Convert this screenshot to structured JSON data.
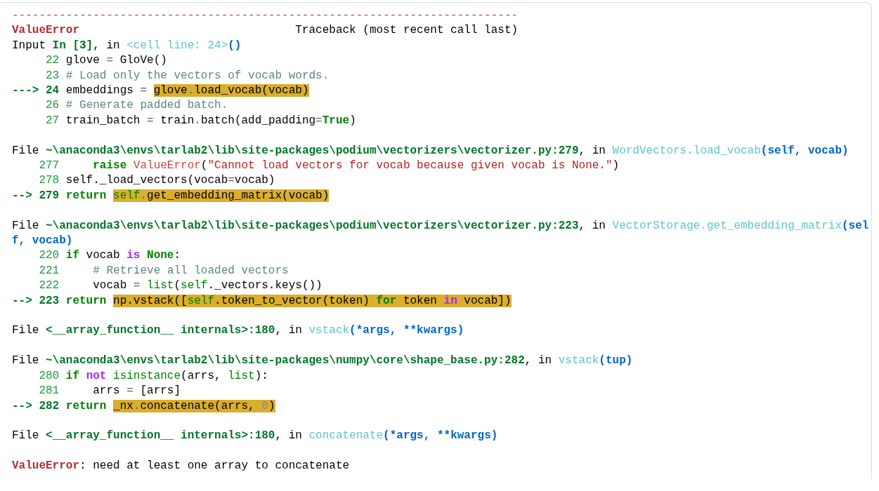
{
  "traceback": {
    "blocks": [
      {
        "lines": [
          {
            "code": [
              {
                "text": "---------------------------------------------------------------------------",
                "kind": "dashes"
              }
            ]
          },
          {
            "code": [
              {
                "text": "ValueError",
                "kind": "error"
              },
              {
                "text": "                                Traceback (most recent call last)",
                "kind": "plain"
              }
            ]
          },
          {
            "code": [
              {
                "text": "Input ",
                "kind": "plain"
              },
              {
                "text": "In [3]",
                "kind": "path"
              },
              {
                "text": ", in ",
                "kind": "plain"
              },
              {
                "text": "<cell line: 24>",
                "kind": "func"
              },
              {
                "text": "()",
                "kind": "args"
              }
            ]
          },
          {
            "code": [
              {
                "text": "     22 ",
                "kind": "lineno"
              },
              {
                "text": "glove ",
                "kind": "plain"
              },
              {
                "text": "=",
                "kind": "op"
              },
              {
                "text": " GloVe()",
                "kind": "plain"
              }
            ]
          },
          {
            "code": [
              {
                "text": "     23 ",
                "kind": "lineno"
              },
              {
                "text": "# Load only the vectors of vocab words.",
                "kind": "comment"
              }
            ]
          },
          {
            "code": [
              {
                "text": "---> 24 ",
                "kind": "arrow"
              },
              {
                "text": "embeddings ",
                "kind": "plain"
              },
              {
                "text": "= ",
                "kind": "op"
              }
            ],
            "highlight": [
              {
                "text": "glove",
                "kind": "plain"
              },
              {
                "text": ".",
                "kind": "op"
              },
              {
                "text": "load_vocab(vocab)",
                "kind": "plain"
              }
            ]
          },
          {
            "code": [
              {
                "text": "     26 ",
                "kind": "lineno"
              },
              {
                "text": "# Generate padded batch.",
                "kind": "comment"
              }
            ]
          },
          {
            "code": [
              {
                "text": "     27 ",
                "kind": "lineno"
              },
              {
                "text": "train_batch ",
                "kind": "plain"
              },
              {
                "text": "=",
                "kind": "op"
              },
              {
                "text": " train",
                "kind": "plain"
              },
              {
                "text": ".",
                "kind": "op"
              },
              {
                "text": "batch(add_padding",
                "kind": "plain"
              },
              {
                "text": "=",
                "kind": "op"
              },
              {
                "text": "True",
                "kind": "keyword"
              },
              {
                "text": ")",
                "kind": "plain"
              }
            ]
          }
        ]
      },
      {
        "lines": [
          {
            "code": [
              {
                "text": "File ",
                "kind": "plain"
              },
              {
                "text": "~\\anaconda3\\envs\\tarlab2\\lib\\site-packages\\podium\\vectorizers\\vectorizer.py:279",
                "kind": "path"
              },
              {
                "text": ", in ",
                "kind": "plain"
              },
              {
                "text": "WordVectors.load_vocab",
                "kind": "func"
              },
              {
                "text": "(self, vocab)",
                "kind": "args"
              }
            ]
          },
          {
            "code": [
              {
                "text": "    277     ",
                "kind": "lineno"
              },
              {
                "text": "raise ",
                "kind": "keyword"
              },
              {
                "text": "ValueError",
                "kind": "exception"
              },
              {
                "text": "(",
                "kind": "plain"
              },
              {
                "text": "\"Cannot load vectors for vocab because given vocab is None.\"",
                "kind": "string"
              },
              {
                "text": ")",
                "kind": "plain"
              }
            ]
          },
          {
            "code": [
              {
                "text": "    278 ",
                "kind": "lineno"
              },
              {
                "text": "self._load_vectors(vocab",
                "kind": "plain"
              },
              {
                "text": "=",
                "kind": "op"
              },
              {
                "text": "vocab)",
                "kind": "plain"
              }
            ]
          },
          {
            "code": [
              {
                "text": "--> 279 ",
                "kind": "arrow"
              },
              {
                "text": "return ",
                "kind": "keyword"
              }
            ],
            "highlight": [
              {
                "text": "self",
                "kind": "builtin"
              },
              {
                "text": ".",
                "kind": "op"
              },
              {
                "text": "get_embedding_matrix(vocab)",
                "kind": "plain"
              }
            ]
          }
        ]
      },
      {
        "lines": [
          {
            "code": [
              {
                "text": "File ",
                "kind": "plain"
              },
              {
                "text": "~\\anaconda3\\envs\\tarlab2\\lib\\site-packages\\podium\\vectorizers\\vectorizer.py:223",
                "kind": "path"
              },
              {
                "text": ", in ",
                "kind": "plain"
              },
              {
                "text": "VectorStorage.get_embedding_matrix",
                "kind": "func"
              },
              {
                "text": "(self, vocab)",
                "kind": "args"
              }
            ]
          },
          {
            "code": [
              {
                "text": "    220 ",
                "kind": "lineno"
              },
              {
                "text": "if",
                "kind": "keyword"
              },
              {
                "text": " vocab ",
                "kind": "plain"
              },
              {
                "text": "is ",
                "kind": "operator-word"
              },
              {
                "text": "None",
                "kind": "keyword"
              },
              {
                "text": ":",
                "kind": "plain"
              }
            ]
          },
          {
            "code": [
              {
                "text": "    221     ",
                "kind": "lineno"
              },
              {
                "text": "# Retrieve all loaded vectors",
                "kind": "comment"
              }
            ]
          },
          {
            "code": [
              {
                "text": "    222     ",
                "kind": "lineno"
              },
              {
                "text": "vocab ",
                "kind": "plain"
              },
              {
                "text": "= ",
                "kind": "op"
              },
              {
                "text": "list",
                "kind": "builtin"
              },
              {
                "text": "(",
                "kind": "plain"
              },
              {
                "text": "self",
                "kind": "builtin"
              },
              {
                "text": "._vectors.keys())",
                "kind": "plain"
              }
            ]
          },
          {
            "code": [
              {
                "text": "--> 223 ",
                "kind": "arrow"
              },
              {
                "text": "return ",
                "kind": "keyword"
              }
            ],
            "highlight": [
              {
                "text": "np.vstack([",
                "kind": "plain"
              },
              {
                "text": "self",
                "kind": "builtin"
              },
              {
                "text": ".token_to_vector(token) ",
                "kind": "plain"
              },
              {
                "text": "for",
                "kind": "keyword"
              },
              {
                "text": " token ",
                "kind": "plain"
              },
              {
                "text": "in",
                "kind": "operator-word"
              },
              {
                "text": " vocab])",
                "kind": "plain"
              }
            ]
          }
        ]
      },
      {
        "lines": [
          {
            "code": [
              {
                "text": "File ",
                "kind": "plain"
              },
              {
                "text": "<__array_function__ internals>:180",
                "kind": "path"
              },
              {
                "text": ", in ",
                "kind": "plain"
              },
              {
                "text": "vstack",
                "kind": "func"
              },
              {
                "text": "(*args, **kwargs)",
                "kind": "args"
              }
            ]
          }
        ]
      },
      {
        "lines": [
          {
            "code": [
              {
                "text": "File ",
                "kind": "plain"
              },
              {
                "text": "~\\anaconda3\\envs\\tarlab2\\lib\\site-packages\\numpy\\core\\shape_base.py:282",
                "kind": "path"
              },
              {
                "text": ", in ",
                "kind": "plain"
              },
              {
                "text": "vstack",
                "kind": "func"
              },
              {
                "text": "(tup)",
                "kind": "args"
              }
            ]
          },
          {
            "code": [
              {
                "text": "    280 ",
                "kind": "lineno"
              },
              {
                "text": "if ",
                "kind": "keyword"
              },
              {
                "text": "not ",
                "kind": "operator-word"
              },
              {
                "text": "isinstance",
                "kind": "builtin"
              },
              {
                "text": "(arrs, ",
                "kind": "plain"
              },
              {
                "text": "list",
                "kind": "builtin"
              },
              {
                "text": "):",
                "kind": "plain"
              }
            ]
          },
          {
            "code": [
              {
                "text": "    281     ",
                "kind": "lineno"
              },
              {
                "text": "arrs ",
                "kind": "plain"
              },
              {
                "text": "=",
                "kind": "op"
              },
              {
                "text": " [arrs]",
                "kind": "plain"
              }
            ]
          },
          {
            "code": [
              {
                "text": "--> 282 ",
                "kind": "arrow"
              },
              {
                "text": "return ",
                "kind": "keyword"
              }
            ],
            "highlight": [
              {
                "text": "_nx",
                "kind": "plain"
              },
              {
                "text": ".",
                "kind": "op"
              },
              {
                "text": "concatenate(arrs, ",
                "kind": "plain"
              },
              {
                "text": "0",
                "kind": "number"
              },
              {
                "text": ")",
                "kind": "plain"
              }
            ]
          }
        ]
      },
      {
        "lines": [
          {
            "code": [
              {
                "text": "File ",
                "kind": "plain"
              },
              {
                "text": "<__array_function__ internals>:180",
                "kind": "path"
              },
              {
                "text": ", in ",
                "kind": "plain"
              },
              {
                "text": "concatenate",
                "kind": "func"
              },
              {
                "text": "(*args, **kwargs)",
                "kind": "args"
              }
            ]
          }
        ]
      },
      {
        "lines": [
          {
            "code": [
              {
                "text": "ValueError",
                "kind": "error"
              },
              {
                "text": ": need at least one array to concatenate",
                "kind": "plain"
              }
            ]
          }
        ]
      }
    ]
  }
}
